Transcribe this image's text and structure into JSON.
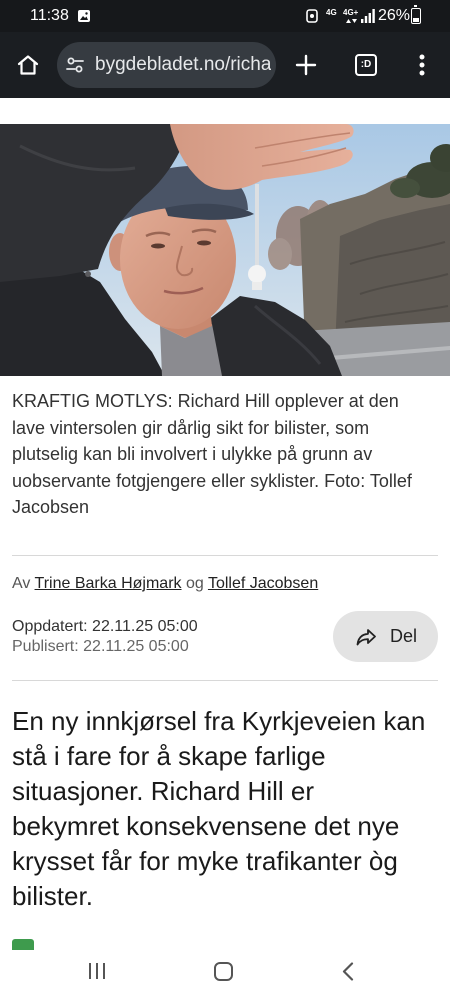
{
  "status_bar": {
    "time": "11:38",
    "network_primary": "4G",
    "network_secondary": "4G+",
    "battery": "26%"
  },
  "browser": {
    "url": "bygdebladet.no/richa",
    "tab_switcher_label": ":D"
  },
  "article": {
    "photo_caption": "KRAFTIG MOTLYS: Richard Hill opplever at den lave vintersolen gir dårlig sikt for bilister, som plutselig kan bli involvert i ulykke på grunn av uobservante fotgjengere eller syklister. Foto: Tollef Jacobsen",
    "byline": {
      "prefix": "Av",
      "authors": [
        "Trine Barka Højmark",
        "Tollef Jacobsen"
      ],
      "conjunction": "og"
    },
    "updated": "Oppdatert: 22.11.25 05:00",
    "published": "Publisert: 22.11.25 05:00",
    "share_label": "Del",
    "lead": "En ny innkjørsel fra Kyrkjeveien kan stå i fare for å skape farlige situasjoner. Richard Hill er bekymret konsekvensene det nye krysset får for myke trafikanter òg bilister."
  },
  "icons": {
    "status": [
      "gallery-icon",
      "notification-icon",
      "signal-icon",
      "battery-icon"
    ],
    "toolbar": [
      "home-icon",
      "tune-icon",
      "plus-icon",
      "tabs-icon",
      "menu-icon"
    ],
    "share": "share-icon",
    "navigation": [
      "recent-apps-icon",
      "home-nav-icon",
      "back-icon"
    ]
  },
  "colors": {
    "status_bar_bg": "#16181b",
    "toolbar_bg": "#1b1e22",
    "url_pill_bg": "#363b41",
    "share_button_bg": "#e3e3e3",
    "badge_green": "#3e9b4d"
  }
}
